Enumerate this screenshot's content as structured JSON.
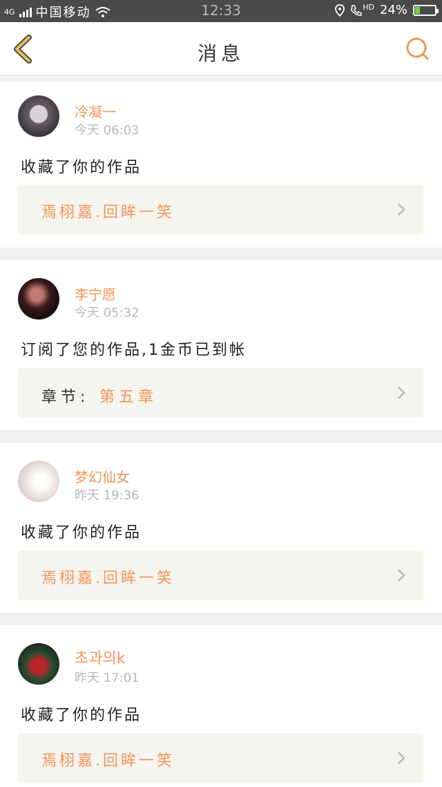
{
  "status_bar": {
    "network": "4G",
    "carrier": "中国移动",
    "time": "12:33",
    "hd": "HD",
    "battery_percent": "24%",
    "battery_level": 0.24
  },
  "header": {
    "title": "消息",
    "back_icon": "chevron-left-icon",
    "search_icon": "search-icon"
  },
  "messages": [
    {
      "name": "冷凝一",
      "time": "今天 06:03",
      "action": "收藏了你的作品",
      "ref_text": "焉栩嘉.回眸一笑"
    },
    {
      "name": "李宁愿",
      "time": "今天 05:32",
      "action": "订阅了您的作品,1金币已到帐",
      "ref_label": "章节:",
      "ref_value": "第五章"
    },
    {
      "name": "梦幻仙女",
      "time": "昨天 19:36",
      "action": "收藏了你的作品",
      "ref_text": "焉栩嘉.回眸一笑"
    },
    {
      "name": "초과의k",
      "time": "昨天 17:01",
      "action": "收藏了你的作品",
      "ref_text": "焉栩嘉.回眸一笑"
    }
  ],
  "colors": {
    "accent": "#f0955a",
    "back_icon": "#e8c25a",
    "status_bg": "#4a4a4a"
  }
}
